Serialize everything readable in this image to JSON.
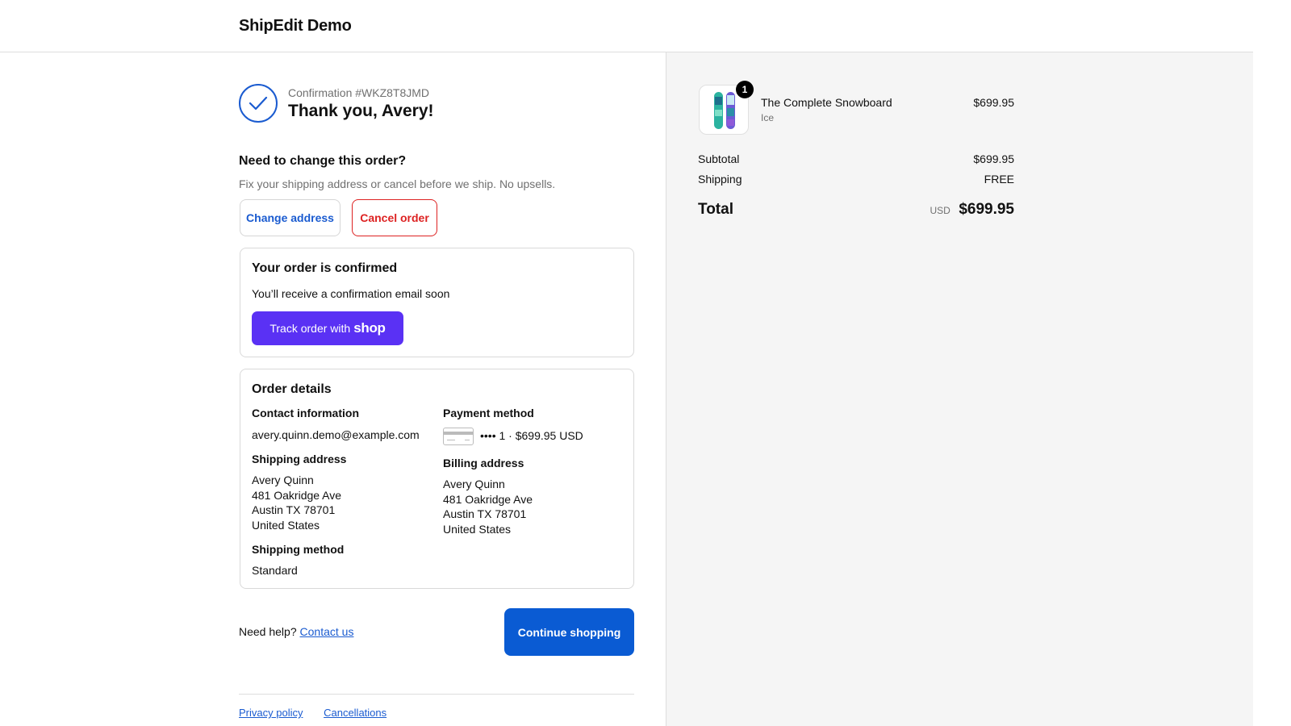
{
  "header": {
    "brand": "ShipEdit Demo"
  },
  "confirmation": {
    "number_label": "Confirmation #WKZ8T8JMD",
    "thank_you": "Thank you, Avery!"
  },
  "change_order": {
    "title": "Need to change this order?",
    "subtitle": "Fix your shipping address or cancel before we ship. No upsells.",
    "change_address_label": "Change address",
    "cancel_order_label": "Cancel order"
  },
  "order_confirmed": {
    "title": "Your order is confirmed",
    "text": "You’ll receive a confirmation email soon",
    "track_prefix": "Track order with",
    "track_brand": "shop"
  },
  "order_details": {
    "title": "Order details",
    "contact_label": "Contact information",
    "contact_email": "avery.quinn.demo@example.com",
    "shipping_address_label": "Shipping address",
    "shipping_address": [
      "Avery Quinn",
      "481 Oakridge Ave",
      "Austin TX 78701",
      "United States"
    ],
    "shipping_method_label": "Shipping method",
    "shipping_method": "Standard",
    "payment_method_label": "Payment method",
    "payment_summary": "•••• 1 · $699.95 USD",
    "billing_address_label": "Billing address",
    "billing_address": [
      "Avery Quinn",
      "481 Oakridge Ave",
      "Austin TX 78701",
      "United States"
    ]
  },
  "help": {
    "prefix": "Need help?",
    "link": "Contact us"
  },
  "continue_label": "Continue shopping",
  "footer": {
    "links": [
      "Privacy policy",
      "Cancellations"
    ]
  },
  "summary": {
    "product_name": "The Complete Snowboard",
    "product_variant": "Ice",
    "product_price": "$699.95",
    "quantity": "1",
    "subtotal_label": "Subtotal",
    "subtotal": "$699.95",
    "shipping_label": "Shipping",
    "shipping": "FREE",
    "total_label": "Total",
    "currency": "USD",
    "total": "$699.95"
  },
  "colors": {
    "accent_blue": "#1a5bd0",
    "primary_button": "#0a5bd3",
    "shop_purple": "#5a31f4",
    "danger_red": "#dd2222"
  }
}
